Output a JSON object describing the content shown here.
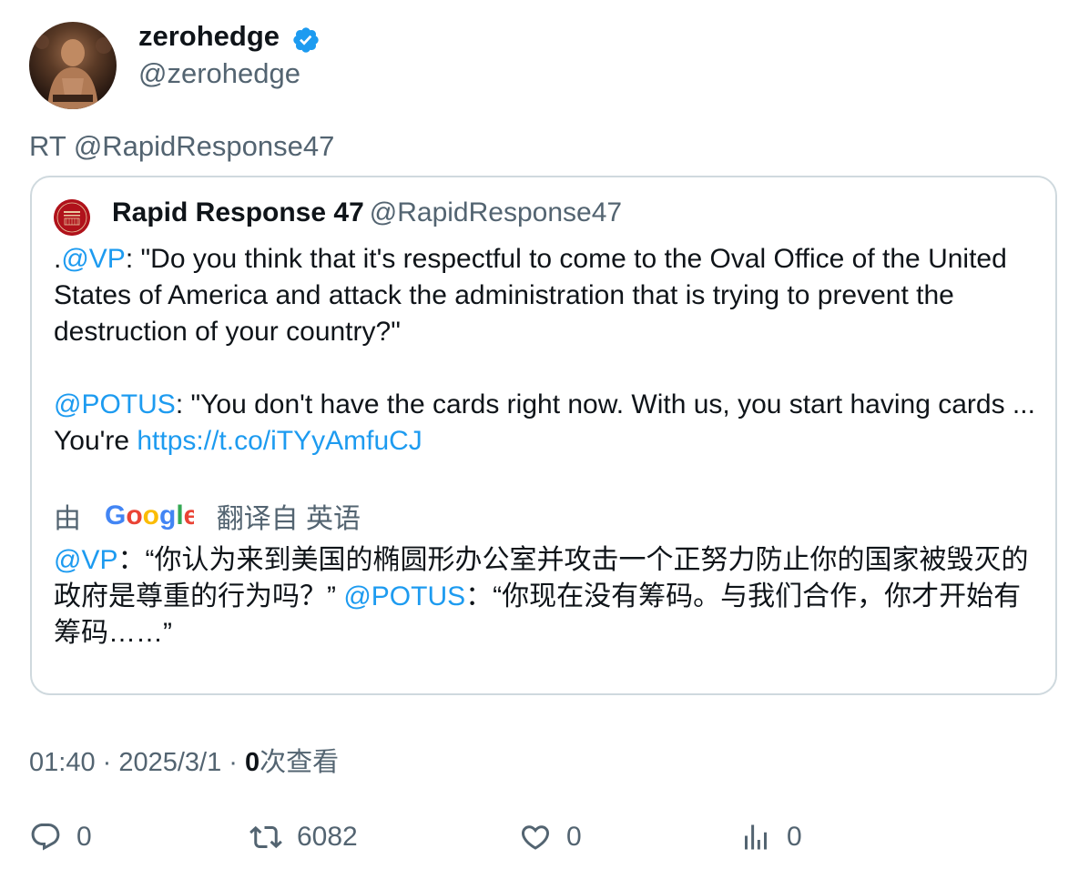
{
  "author": {
    "display_name": "zerohedge",
    "handle": "@zerohedge",
    "verified": true,
    "avatar_icon": "profile-photo"
  },
  "retweet_text": "RT @RapidResponse47",
  "quote": {
    "display_name": "Rapid Response 47",
    "handle": "@RapidResponse47",
    "avatar_icon": "rapid-response-seal",
    "text": {
      "p1_prefix": ".",
      "p1_mention": "@VP",
      "p1_body": ": \"Do you think that it's respectful to come to the Oval Office of the United States of America and attack the administration that is trying to prevent the destruction of your country?\"",
      "p2_mention": "@POTUS",
      "p2_body": ": \"You don't have the cards right now. With us, you start having cards ... You're ",
      "p2_link": "https://t.co/iTYyAmfuCJ"
    },
    "translation": {
      "by_label": "由",
      "provider": "Google",
      "from_label": "翻译自 英语",
      "mention1": "@VP",
      "text1": "：“你认为来到美国的椭圆形办公室并攻击一个正努力防止你的国家被毁灭的政府是尊重的行为吗？” ",
      "mention2": "@POTUS",
      "text2": "：“你现在没有筹码。与我们合作，你才开始有筹码……”"
    }
  },
  "meta": {
    "time": "01:40",
    "separator": " · ",
    "date": "2025/3/1",
    "views_count": "0",
    "views_label": "次查看"
  },
  "actions": {
    "replies": "0",
    "retweets": "6082",
    "likes": "0",
    "views": "0"
  },
  "colors": {
    "link": "#1d9bf0",
    "verified": "#1d9bf0",
    "muted": "#536471",
    "border": "#cfd9de"
  }
}
